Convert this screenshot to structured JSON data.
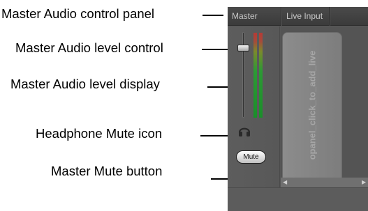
{
  "callouts": {
    "control_panel": "Master Audio control panel",
    "level_control": "Master Audio level control",
    "level_display": "Master Audio level display",
    "headphone_mute": "Headphone Mute icon",
    "mute_button": "Master Mute button"
  },
  "panel": {
    "tabs": {
      "master": "Master",
      "live_input": "Live Input"
    },
    "mute_label": "Mute",
    "add_live_label": "opanel_click_to_add_live"
  },
  "colors": {
    "panel_bg": "#575757",
    "meter_red": "#b63a35",
    "meter_green": "#1a8f2a"
  }
}
